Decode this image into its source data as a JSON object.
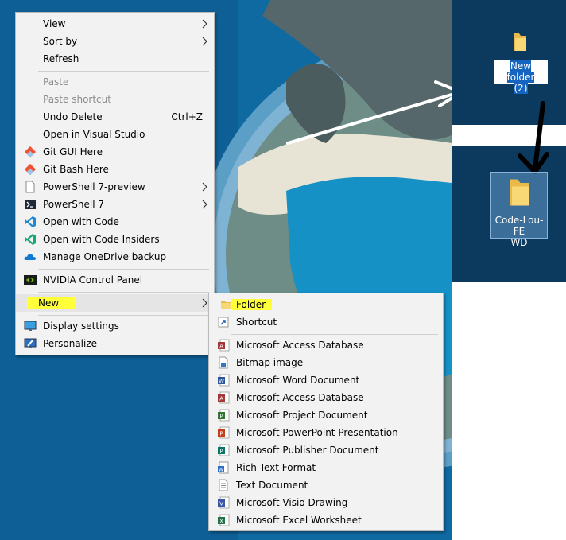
{
  "context_menu": {
    "items": [
      {
        "label": "View",
        "submenu": true
      },
      {
        "label": "Sort by",
        "submenu": true
      },
      {
        "label": "Refresh"
      },
      {
        "label": "Paste",
        "disabled": true
      },
      {
        "label": "Paste shortcut",
        "disabled": true
      },
      {
        "label": "Undo Delete",
        "shortcut": "Ctrl+Z"
      },
      {
        "label": "Open in Visual Studio"
      },
      {
        "label": "Git GUI Here",
        "icon": "git-icon"
      },
      {
        "label": "Git Bash Here",
        "icon": "git-icon"
      },
      {
        "label": "PowerShell 7-preview",
        "icon": "document-icon",
        "submenu": true
      },
      {
        "label": "PowerShell 7",
        "icon": "powershell-icon",
        "submenu": true
      },
      {
        "label": "Open with Code",
        "icon": "vscode-icon"
      },
      {
        "label": "Open with Code Insiders",
        "icon": "vscode-insiders-icon"
      },
      {
        "label": "Manage OneDrive backup",
        "icon": "onedrive-icon"
      },
      {
        "label": "NVIDIA Control Panel",
        "icon": "nvidia-icon"
      },
      {
        "label": "New",
        "submenu": true,
        "highlighted": true
      },
      {
        "label": "Display settings",
        "icon": "display-icon"
      },
      {
        "label": "Personalize",
        "icon": "personalize-icon"
      }
    ]
  },
  "new_submenu": {
    "items": [
      {
        "label": "Folder",
        "icon": "folder-icon",
        "highlighted": true
      },
      {
        "label": "Shortcut",
        "icon": "shortcut-icon"
      },
      {
        "label": "Microsoft Access Database",
        "icon": "access-icon"
      },
      {
        "label": "Bitmap image",
        "icon": "bitmap-icon"
      },
      {
        "label": "Microsoft Word Document",
        "icon": "word-icon"
      },
      {
        "label": "Microsoft Access Database",
        "icon": "access-icon"
      },
      {
        "label": "Microsoft Project Document",
        "icon": "project-icon"
      },
      {
        "label": "Microsoft PowerPoint Presentation",
        "icon": "powerpoint-icon"
      },
      {
        "label": "Microsoft Publisher Document",
        "icon": "publisher-icon"
      },
      {
        "label": "Rich Text Format",
        "icon": "wordpad-icon"
      },
      {
        "label": "Text Document",
        "icon": "text-document-icon"
      },
      {
        "label": "Microsoft Visio Drawing",
        "icon": "visio-icon"
      },
      {
        "label": "Microsoft Excel Worksheet",
        "icon": "excel-icon"
      }
    ]
  },
  "desktop_icons": [
    {
      "label_line1": "New folder",
      "label_line2": "(2)",
      "state": "renaming"
    },
    {
      "label_line1": "Code-Lou-FE",
      "label_line2": "WD",
      "state": "selected"
    }
  ],
  "colors": {
    "highlight": "#ffff3a",
    "menu_bg": "#f2f2f2",
    "desktop_blue": "#0b3a5e",
    "wallpaper_blue": "#0e6aa3"
  }
}
